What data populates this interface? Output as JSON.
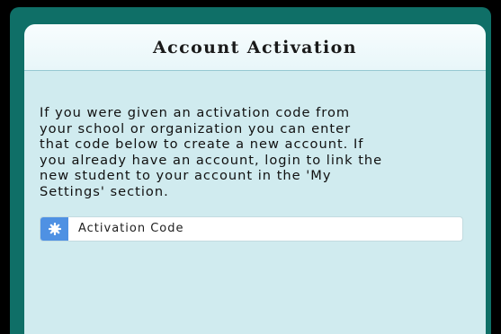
{
  "activation": {
    "title": "Account Activation",
    "description": "If you were given an activation code from\nyour school or organization you can enter\nthat code below to create a new account. If\nyou already have an account, login to link the\nnew student to your account in the 'My\nSettings' section.",
    "code_field": {
      "placeholder": "Activation Code",
      "value": "",
      "icon": "gear-icon"
    }
  },
  "colors": {
    "frame": "#0f6f67",
    "card": "#d0ebef",
    "header": "#f3fbfc",
    "accent": "#4f91e3"
  }
}
